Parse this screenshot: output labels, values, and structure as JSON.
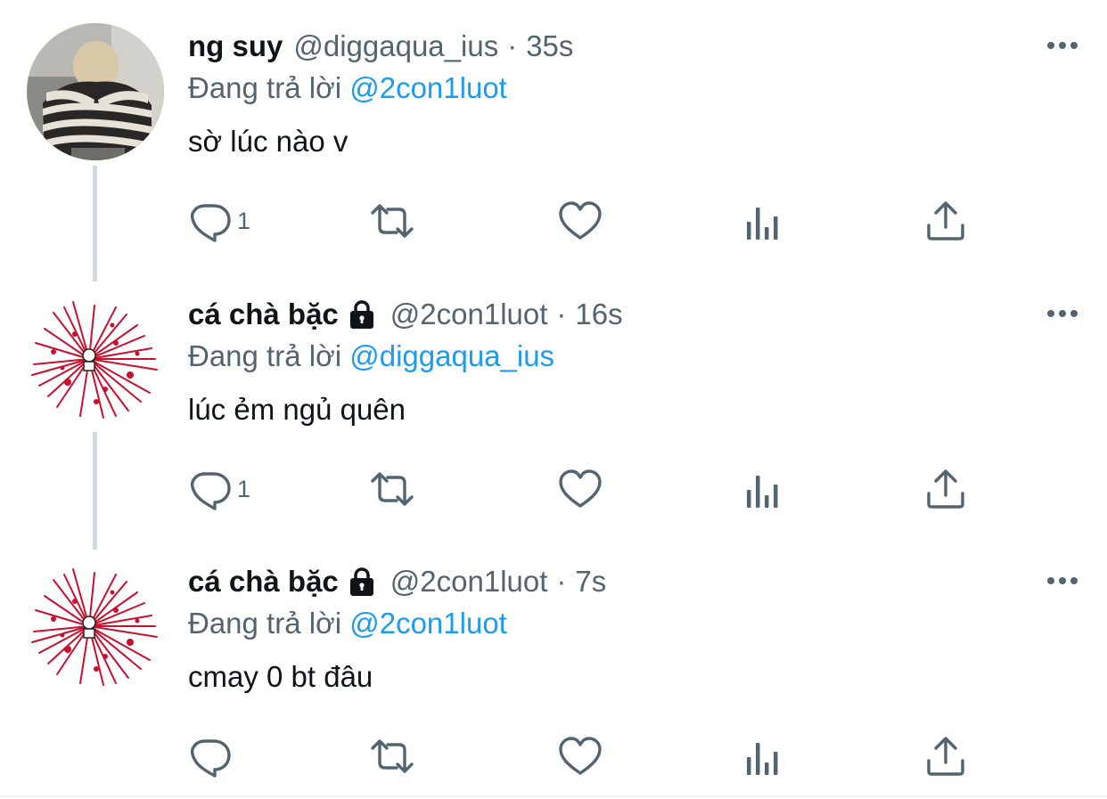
{
  "tweets": [
    {
      "display_name": "ng suy",
      "locked": false,
      "handle": "@diggaqua_ius",
      "separator": "·",
      "time": "35s",
      "reply_prefix": "Đang trả lời",
      "reply_to": "@2con1luot",
      "text": "sờ lúc nào v",
      "reply_count": "1",
      "avatar": "photo-striped-sweater-avatar"
    },
    {
      "display_name": "cá chà bặc",
      "locked": true,
      "handle": "@2con1luot",
      "separator": "·",
      "time": "16s",
      "reply_prefix": "Đang trả lời",
      "reply_to": "@diggaqua_ius",
      "text": "lúc ẻm ngủ quên",
      "reply_count": "1",
      "avatar": "red-burst-avatar"
    },
    {
      "display_name": "cá chà bặc",
      "locked": true,
      "handle": "@2con1luot",
      "separator": "·",
      "time": "7s",
      "reply_prefix": "Đang trả lời",
      "reply_to": "@2con1luot",
      "text": "cmay 0 bt đâu",
      "reply_count": "",
      "avatar": "red-burst-avatar"
    }
  ],
  "icons": {
    "reply": "reply-icon",
    "retweet": "retweet-icon",
    "like": "heart-icon",
    "views": "views-icon",
    "share": "share-icon",
    "more": "more-icon",
    "lock": "lock-icon"
  },
  "colors": {
    "text": "#0f1419",
    "secondary": "#536471",
    "mention": "#1d9bf0",
    "thread_line": "#cfd9de",
    "icon": "#536471",
    "avatar_burst": "#c8102e"
  }
}
